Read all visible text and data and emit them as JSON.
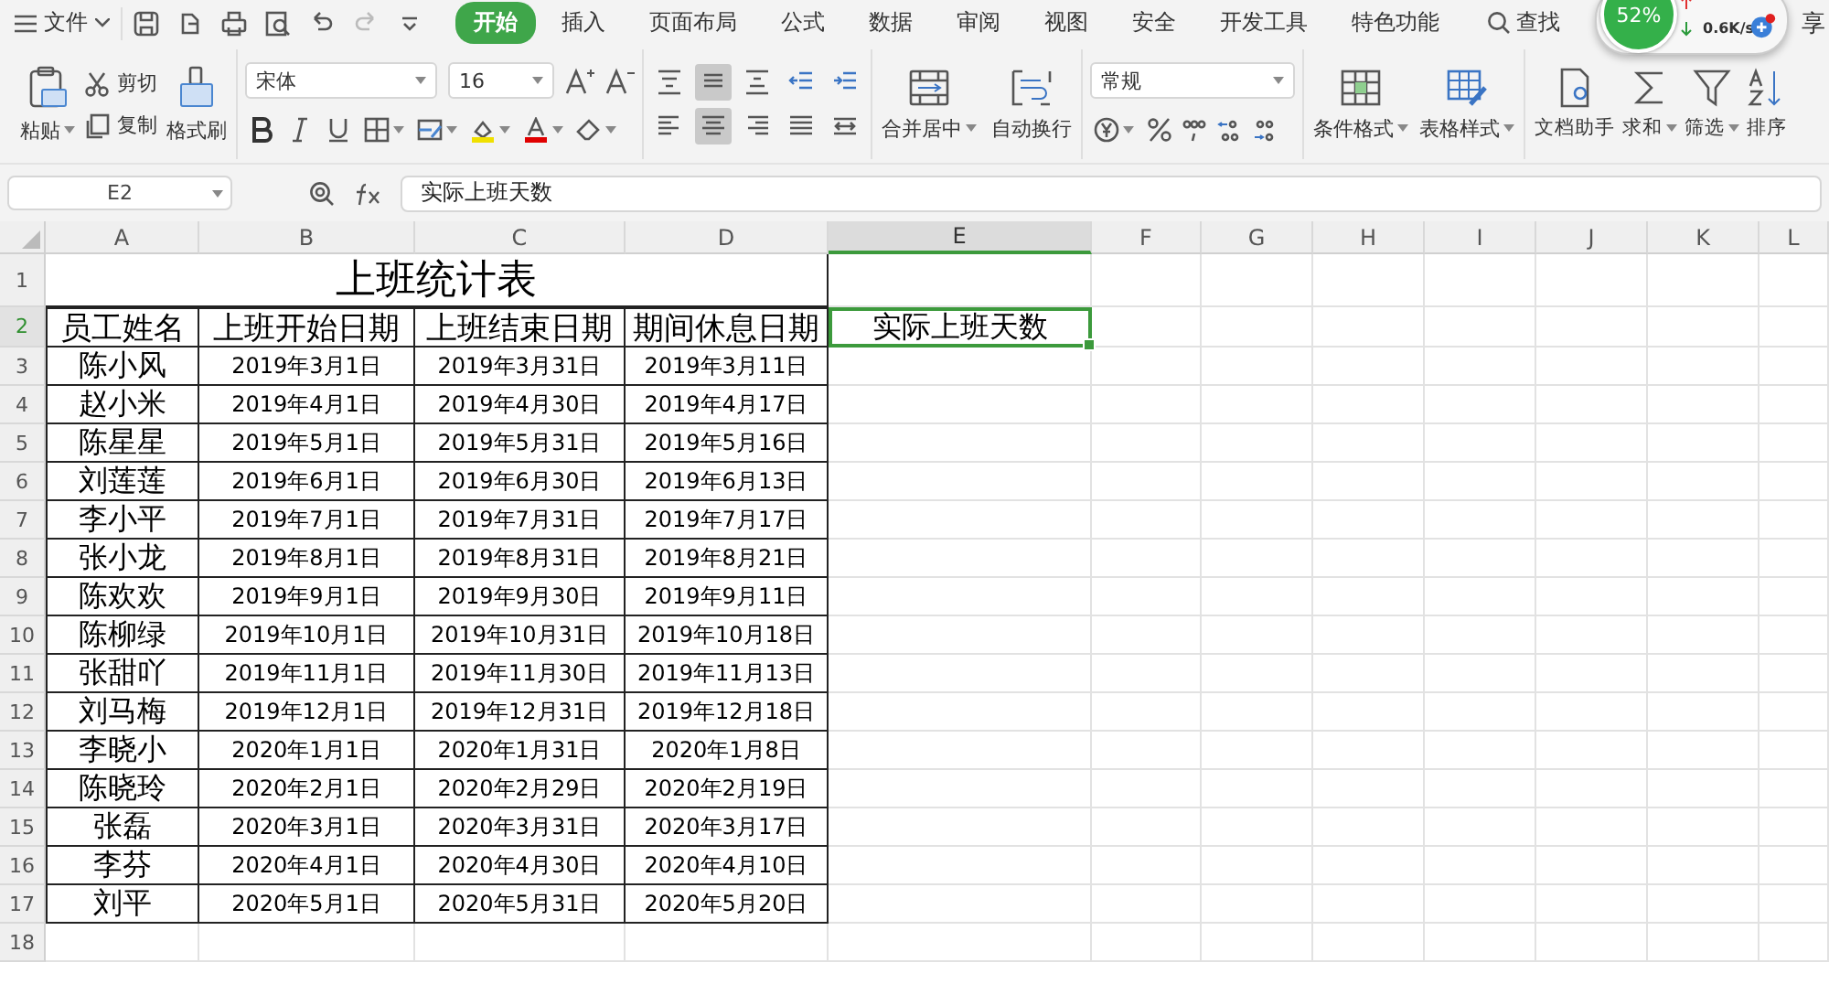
{
  "menu": {
    "file": "文件",
    "tabs": [
      {
        "label": "开始",
        "selected": true
      },
      {
        "label": "插入",
        "selected": false
      },
      {
        "label": "页面布局",
        "selected": false
      },
      {
        "label": "公式",
        "selected": false
      },
      {
        "label": "数据",
        "selected": false
      },
      {
        "label": "审阅",
        "selected": false
      },
      {
        "label": "视图",
        "selected": false
      },
      {
        "label": "安全",
        "selected": false
      },
      {
        "label": "开发工具",
        "selected": false
      },
      {
        "label": "特色功能",
        "selected": false
      }
    ],
    "search": "查找",
    "partial_tab": "享"
  },
  "ribbon": {
    "paste": "粘贴",
    "cut": "剪切",
    "copy": "复制",
    "format_painter": "格式刷",
    "font_name": "宋体",
    "font_size": "16",
    "align_buttons": [
      {
        "selected": false
      },
      {
        "selected": true
      },
      {
        "selected": false
      },
      {
        "selected": false
      },
      {
        "selected": false
      },
      {
        "selected": false
      },
      {
        "selected": true
      },
      {
        "selected": false
      },
      {
        "selected": false
      },
      {
        "selected": false
      }
    ],
    "merge": "合并居中",
    "wrap": "自动换行",
    "number_format": "常规",
    "conditional_format": "条件格式",
    "table_style": "表格样式",
    "tools": [
      "文档助手",
      "求和",
      "筛选",
      "排序"
    ]
  },
  "network_widget": {
    "percent": "52%",
    "download": "0.6K/s"
  },
  "formula_bar": {
    "name_box": "E2",
    "formula": "实际上班天数"
  },
  "sheet": {
    "columns": [
      {
        "label": "A",
        "selected": false
      },
      {
        "label": "B",
        "selected": false
      },
      {
        "label": "C",
        "selected": false
      },
      {
        "label": "D",
        "selected": false
      },
      {
        "label": "E",
        "selected": true
      },
      {
        "label": "F",
        "selected": false
      },
      {
        "label": "G",
        "selected": false
      },
      {
        "label": "H",
        "selected": false
      },
      {
        "label": "I",
        "selected": false
      },
      {
        "label": "J",
        "selected": false
      },
      {
        "label": "K",
        "selected": false
      },
      {
        "label": "L",
        "selected": false
      }
    ],
    "row_numbers": [
      {
        "label": "1",
        "selected": false
      },
      {
        "label": "2",
        "selected": true
      },
      {
        "label": "3",
        "selected": false
      },
      {
        "label": "4",
        "selected": false
      },
      {
        "label": "5",
        "selected": false
      },
      {
        "label": "6",
        "selected": false
      },
      {
        "label": "7",
        "selected": false
      },
      {
        "label": "8",
        "selected": false
      },
      {
        "label": "9",
        "selected": false
      },
      {
        "label": "10",
        "selected": false
      },
      {
        "label": "11",
        "selected": false
      },
      {
        "label": "12",
        "selected": false
      },
      {
        "label": "13",
        "selected": false
      },
      {
        "label": "14",
        "selected": false
      },
      {
        "label": "15",
        "selected": false
      },
      {
        "label": "16",
        "selected": false
      },
      {
        "label": "17",
        "selected": false
      },
      {
        "label": "18",
        "selected": false
      }
    ],
    "title": "上班统计表",
    "headers": [
      "员工姓名",
      "上班开始日期",
      "上班结束日期",
      "期间休息日期"
    ],
    "active_cell": "实际上班天数",
    "rows": [
      [
        "陈小风",
        "2019年3月1日",
        "2019年3月31日",
        "2019年3月11日"
      ],
      [
        "赵小米",
        "2019年4月1日",
        "2019年4月30日",
        "2019年4月17日"
      ],
      [
        "陈星星",
        "2019年5月1日",
        "2019年5月31日",
        "2019年5月16日"
      ],
      [
        "刘莲莲",
        "2019年6月1日",
        "2019年6月30日",
        "2019年6月13日"
      ],
      [
        "李小平",
        "2019年7月1日",
        "2019年7月31日",
        "2019年7月17日"
      ],
      [
        "张小龙",
        "2019年8月1日",
        "2019年8月31日",
        "2019年8月21日"
      ],
      [
        "陈欢欢",
        "2019年9月1日",
        "2019年9月30日",
        "2019年9月11日"
      ],
      [
        "陈柳绿",
        "2019年10月1日",
        "2019年10月31日",
        "2019年10月18日"
      ],
      [
        "张甜吖",
        "2019年11月1日",
        "2019年11月30日",
        "2019年11月13日"
      ],
      [
        "刘马梅",
        "2019年12月1日",
        "2019年12月31日",
        "2019年12月18日"
      ],
      [
        "李晓小",
        "2020年1月1日",
        "2020年1月31日",
        "2020年1月8日"
      ],
      [
        "陈晓玲",
        "2020年2月1日",
        "2020年2月29日",
        "2020年2月19日"
      ],
      [
        "张磊",
        "2020年3月1日",
        "2020年3月31日",
        "2020年3月17日"
      ],
      [
        "李芬",
        "2020年4月1日",
        "2020年4月30日",
        "2020年4月10日"
      ],
      [
        "刘平",
        "2020年5月1日",
        "2020年5月31日",
        "2020年5月20日"
      ]
    ]
  }
}
